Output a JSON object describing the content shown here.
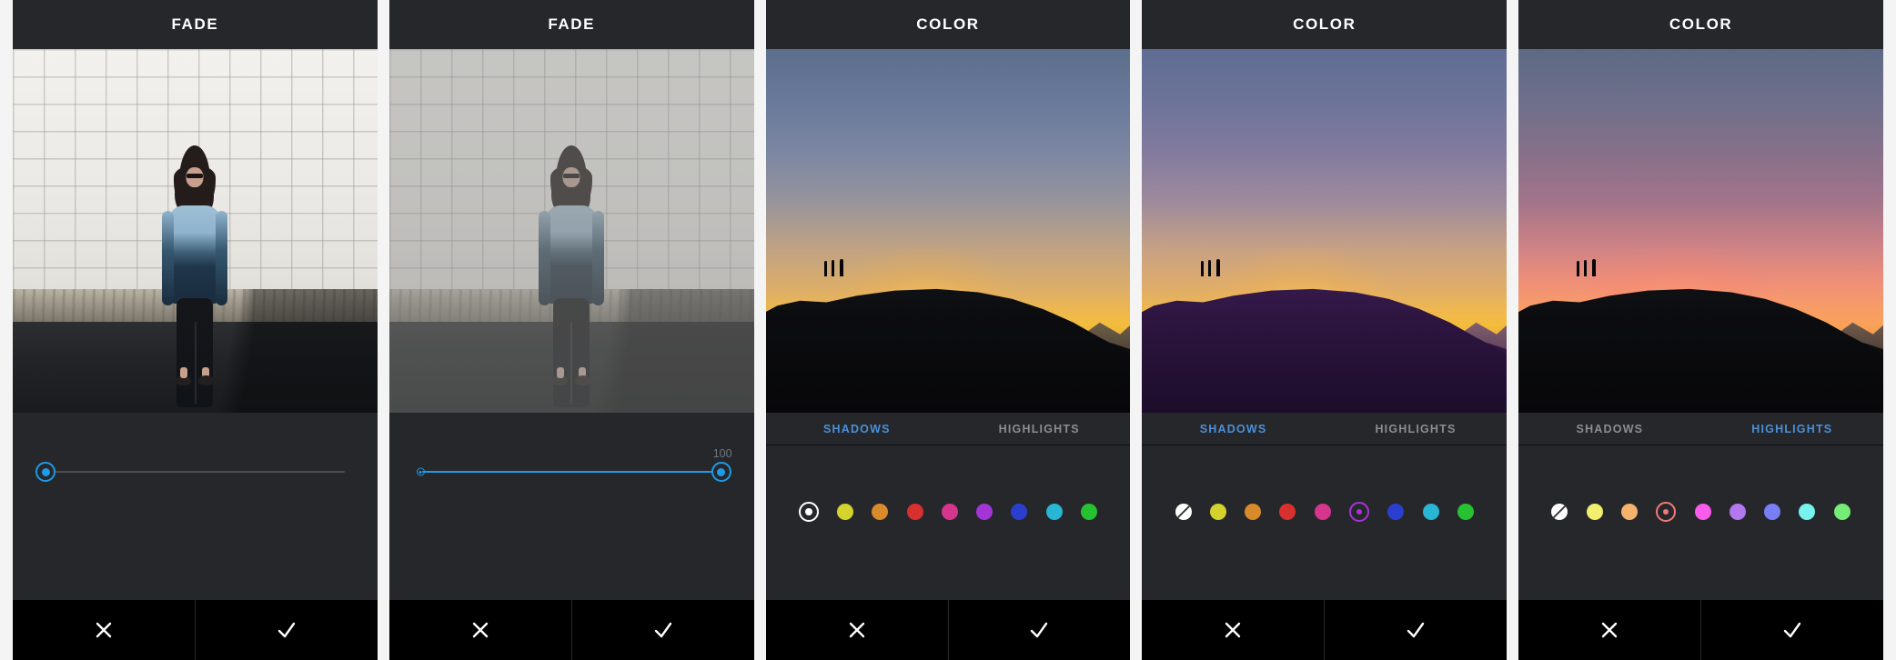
{
  "theme": {
    "page_background": "#f4f4f4",
    "panel_background": "#26272b",
    "header_background": "#26272b",
    "accent_blue": "#1e9ae6",
    "tab_active_blue": "#4a90d9",
    "action_bar_background": "#000000"
  },
  "panels": [
    {
      "id": "fade-zero",
      "title": "FADE",
      "control_type": "slider",
      "slider": {
        "value": 0,
        "min": 0,
        "max": 100,
        "value_label": "",
        "knob_percent": 0,
        "fill_percent": 0,
        "show_origin_dot": false
      },
      "photo": "wall-portrait",
      "actions": {
        "cancel": "✕",
        "confirm": "✓"
      }
    },
    {
      "id": "fade-hundred",
      "title": "FADE",
      "control_type": "slider",
      "slider": {
        "value": 100,
        "min": 0,
        "max": 100,
        "value_label": "100",
        "knob_percent": 100,
        "fill_percent": 100,
        "show_origin_dot": true
      },
      "photo": "wall-portrait-faded",
      "actions": {
        "cancel": "✕",
        "confirm": "✓"
      }
    },
    {
      "id": "color-shadows-none",
      "title": "COLOR",
      "control_type": "swatches",
      "tabs": [
        {
          "label": "SHADOWS",
          "active": true
        },
        {
          "label": "HIGHLIGHTS",
          "active": false
        }
      ],
      "swatches": [
        {
          "name": "none",
          "color": "#ffffff",
          "selected": true,
          "style": "white-ring"
        },
        {
          "name": "yellow",
          "color": "#d4d32e",
          "selected": false
        },
        {
          "name": "orange",
          "color": "#d98b2b",
          "selected": false
        },
        {
          "name": "red",
          "color": "#d8302e",
          "selected": false
        },
        {
          "name": "pink",
          "color": "#d6358e",
          "selected": false
        },
        {
          "name": "purple",
          "color": "#a335d6",
          "selected": false
        },
        {
          "name": "blue",
          "color": "#2a3fd0",
          "selected": false
        },
        {
          "name": "cyan",
          "color": "#28b6d4",
          "selected": false
        },
        {
          "name": "green",
          "color": "#26c231",
          "selected": false
        }
      ],
      "photo": "sunset",
      "actions": {
        "cancel": "✕",
        "confirm": "✓"
      }
    },
    {
      "id": "color-shadows-purple",
      "title": "COLOR",
      "control_type": "swatches",
      "tabs": [
        {
          "label": "SHADOWS",
          "active": true
        },
        {
          "label": "HIGHLIGHTS",
          "active": false
        }
      ],
      "swatches": [
        {
          "name": "none",
          "color": "#ffffff",
          "selected": false,
          "style": "slash"
        },
        {
          "name": "yellow",
          "color": "#d4d32e",
          "selected": false
        },
        {
          "name": "orange",
          "color": "#d98b2b",
          "selected": false
        },
        {
          "name": "red",
          "color": "#d8302e",
          "selected": false
        },
        {
          "name": "pink",
          "color": "#d6358e",
          "selected": false
        },
        {
          "name": "purple",
          "color": "#a335d6",
          "selected": true
        },
        {
          "name": "blue",
          "color": "#2a3fd0",
          "selected": false
        },
        {
          "name": "cyan",
          "color": "#28b6d4",
          "selected": false
        },
        {
          "name": "green",
          "color": "#26c231",
          "selected": false
        }
      ],
      "photo": "sunset-purple-shadows",
      "actions": {
        "cancel": "✕",
        "confirm": "✓"
      }
    },
    {
      "id": "color-highlights-red",
      "title": "COLOR",
      "control_type": "swatches",
      "tabs": [
        {
          "label": "SHADOWS",
          "active": false
        },
        {
          "label": "HIGHLIGHTS",
          "active": true
        }
      ],
      "swatches": [
        {
          "name": "none",
          "color": "#ffffff",
          "selected": false,
          "style": "slash"
        },
        {
          "name": "yellow",
          "color": "#f2ef6e",
          "selected": false
        },
        {
          "name": "orange",
          "color": "#f5b26a",
          "selected": false
        },
        {
          "name": "red",
          "color": "#f07a78",
          "selected": true
        },
        {
          "name": "pink",
          "color": "#f95ced",
          "selected": false
        },
        {
          "name": "purple",
          "color": "#b377ef",
          "selected": false
        },
        {
          "name": "blue",
          "color": "#7a7ef5",
          "selected": false
        },
        {
          "name": "cyan",
          "color": "#76f2ef",
          "selected": false
        },
        {
          "name": "green",
          "color": "#76ec76",
          "selected": false
        }
      ],
      "photo": "sunset-pink-highlights",
      "actions": {
        "cancel": "✕",
        "confirm": "✓"
      }
    }
  ]
}
